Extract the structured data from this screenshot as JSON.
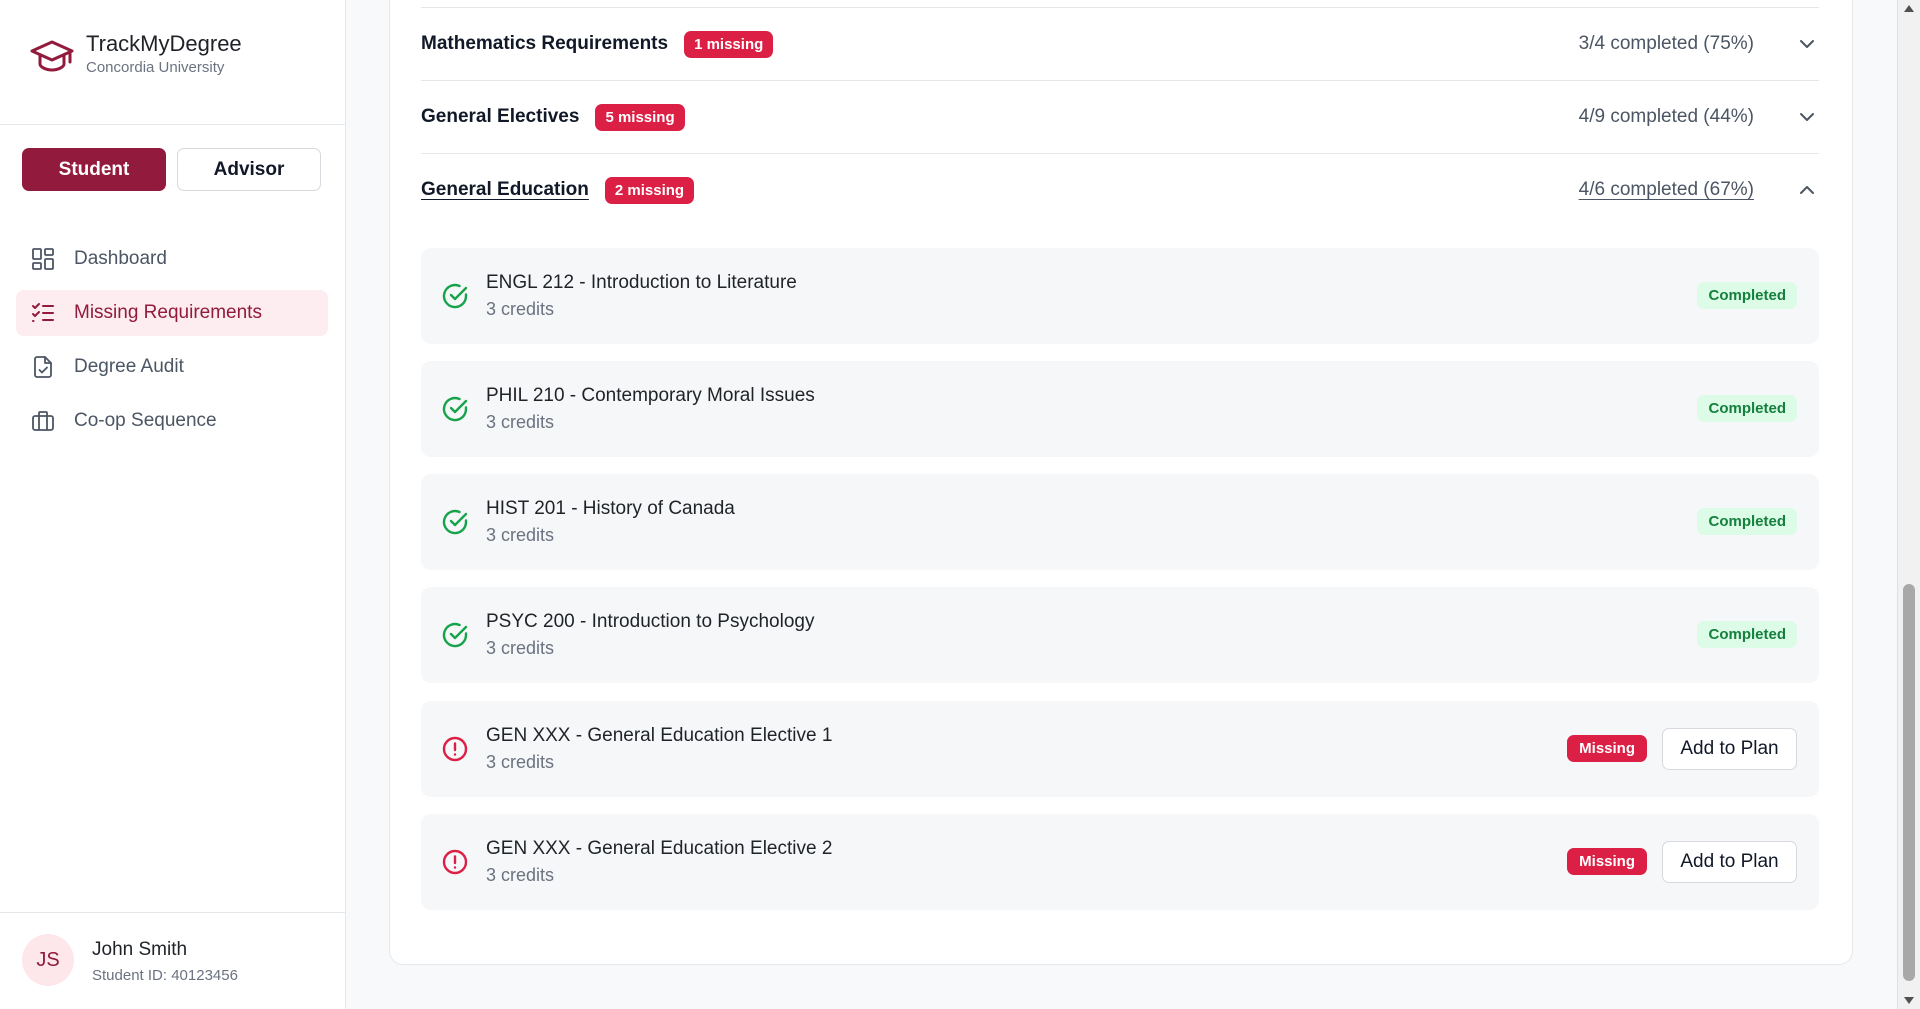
{
  "brand": {
    "app_name": "TrackMyDegree",
    "university": "Concordia University"
  },
  "roles": {
    "student_label": "Student",
    "advisor_label": "Advisor",
    "active": "Student"
  },
  "nav": {
    "items": [
      {
        "label": "Dashboard",
        "icon": "dashboard-grid-icon",
        "active": false
      },
      {
        "label": "Missing Requirements",
        "icon": "list-checks-icon",
        "active": true
      },
      {
        "label": "Degree Audit",
        "icon": "file-check-icon",
        "active": false
      },
      {
        "label": "Co-op Sequence",
        "icon": "briefcase-icon",
        "active": false
      }
    ]
  },
  "user": {
    "initials": "JS",
    "name": "John Smith",
    "student_id": "Student ID: 40123456"
  },
  "sections": [
    {
      "title": "Mathematics Requirements",
      "missing_badge": "1 missing",
      "progress": "3/4 completed (75%)",
      "expanded": false
    },
    {
      "title": "General Electives",
      "missing_badge": "5 missing",
      "progress": "4/9 completed (44%)",
      "expanded": false
    },
    {
      "title": "General Education",
      "missing_badge": "2 missing",
      "progress": "4/6 completed (67%)",
      "expanded": true
    }
  ],
  "courses": [
    {
      "name": "ENGL 212 - Introduction to Literature",
      "credits": "3 credits",
      "status": "Completed"
    },
    {
      "name": "PHIL 210 - Contemporary Moral Issues",
      "credits": "3 credits",
      "status": "Completed"
    },
    {
      "name": "HIST 201 - History of Canada",
      "credits": "3 credits",
      "status": "Completed"
    },
    {
      "name": "PSYC 200 - Introduction to Psychology",
      "credits": "3 credits",
      "status": "Completed"
    },
    {
      "name": "GEN XXX - General Education Elective 1",
      "credits": "3 credits",
      "status": "Missing",
      "action": "Add to Plan"
    },
    {
      "name": "GEN XXX - General Education Elective 2",
      "credits": "3 credits",
      "status": "Missing",
      "action": "Add to Plan"
    }
  ],
  "colors": {
    "brand": "#921a3c",
    "missing": "#dc1f45",
    "completed_text": "#15803d",
    "completed_bg": "#dcfce7"
  }
}
